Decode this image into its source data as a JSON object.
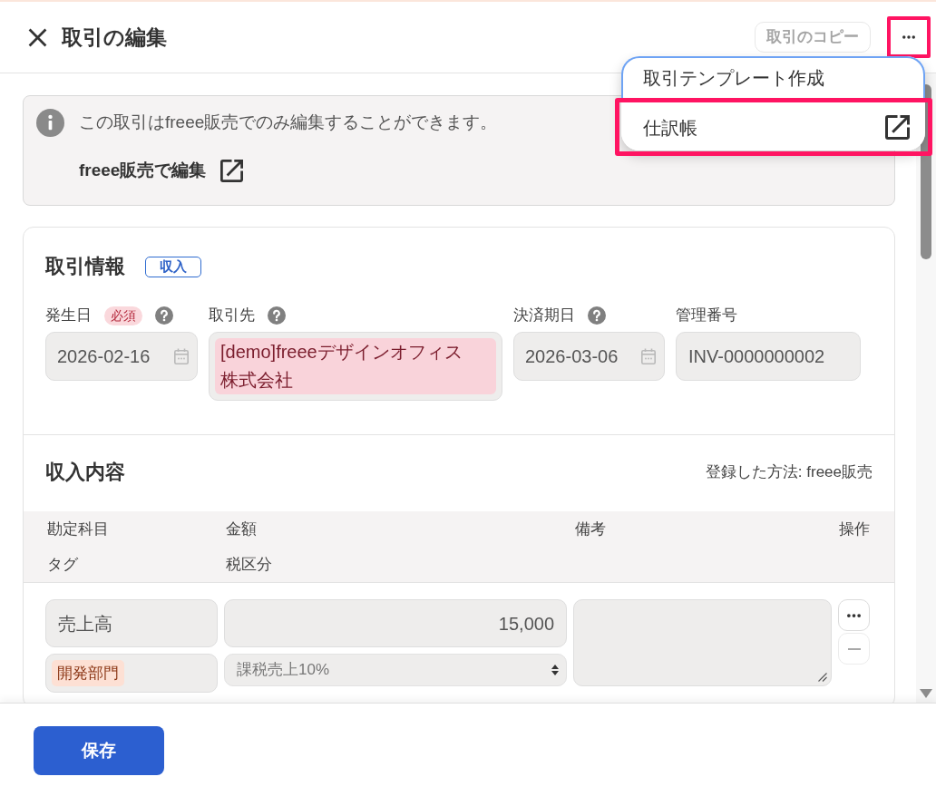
{
  "header": {
    "title": "取引の編集",
    "copy_button": {
      "label": "取引のコピー",
      "disabled": true
    },
    "more_button": {
      "highlighted": true
    }
  },
  "menu": {
    "items": [
      {
        "label": "取引テンプレート作成",
        "external": false,
        "focused": true,
        "highlighted": false
      },
      {
        "label": "仕訳帳",
        "external": true,
        "focused": false,
        "highlighted": true
      }
    ]
  },
  "notice": {
    "message": "この取引はfreee販売でのみ編集することができます。",
    "link": "freee販売で編集"
  },
  "transaction": {
    "title": "取引情報",
    "type_badge": "収入",
    "fields": [
      {
        "label": "発生日",
        "required_badge": "必須",
        "help": true,
        "kind": "date",
        "value": "2026-02-16"
      },
      {
        "label": "取引先",
        "help": true,
        "kind": "partner",
        "value": "[demo]freeeデザインオフィス株式会社"
      },
      {
        "label": "決済期日",
        "help": true,
        "kind": "date",
        "value": "2026-03-06"
      },
      {
        "label": "管理番号",
        "help": false,
        "kind": "text",
        "value": "INV-0000000002"
      }
    ]
  },
  "details": {
    "title": "収入内容",
    "registration": "登録した方法: freee販売",
    "columns": [
      {
        "top": "勘定科目",
        "bottom": "タグ"
      },
      {
        "top": "金額",
        "bottom": "税区分"
      },
      {
        "top": "備考"
      },
      {
        "top": "操作"
      }
    ],
    "rows": [
      {
        "account": "売上高",
        "amount": "15,000",
        "tag": "開発部門",
        "tax": "課税売上10%"
      }
    ]
  },
  "footer": {
    "save_button": "保存"
  }
}
